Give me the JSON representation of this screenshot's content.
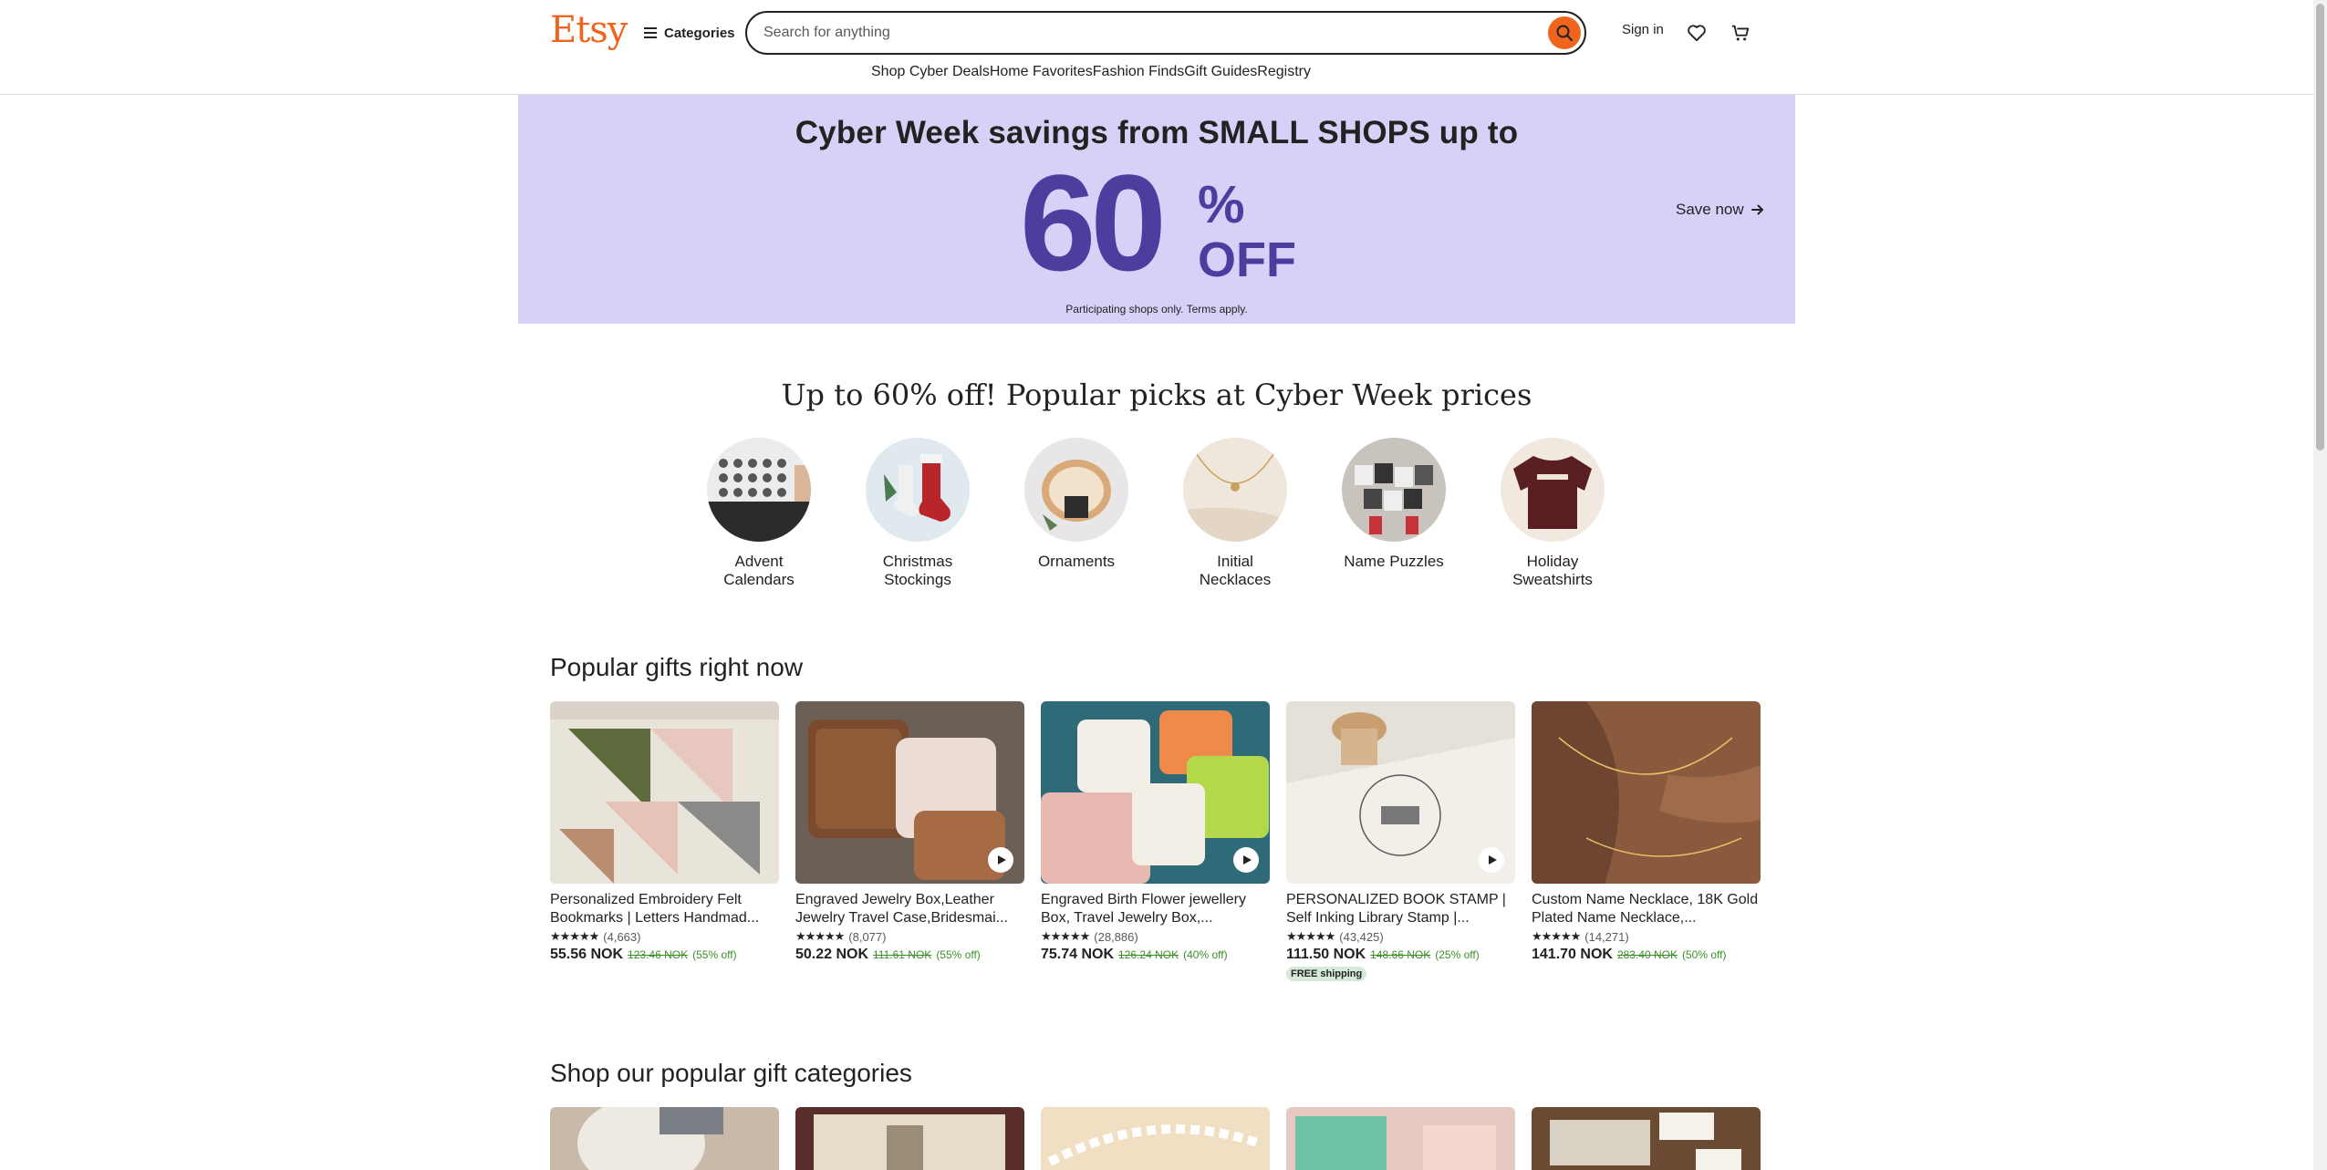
{
  "header": {
    "logo": "Etsy",
    "categories_label": "Categories",
    "search_placeholder": "Search for anything",
    "signin_label": "Sign in",
    "nav": [
      "Shop Cyber Deals",
      "Home Favorites",
      "Fashion Finds",
      "Gift Guides",
      "Registry"
    ]
  },
  "banner": {
    "headline": "Cyber Week savings from SMALL SHOPS up to",
    "big_number": "60",
    "percent": "%",
    "off": "OFF",
    "fine_print": "Participating shops only. Terms apply.",
    "cta": "Save now"
  },
  "picks": {
    "title": "Up to 60% off! Popular picks at Cyber Week prices",
    "items": [
      {
        "label": "Advent Calendars"
      },
      {
        "label": "Christmas Stockings"
      },
      {
        "label": "Ornaments"
      },
      {
        "label": "Initial Necklaces"
      },
      {
        "label": "Name Puzzles"
      },
      {
        "label": "Holiday Sweatshirts"
      }
    ]
  },
  "popular": {
    "title": "Popular gifts right now",
    "items": [
      {
        "title": "Personalized Embroidery Felt Bookmarks | Letters Handmad...",
        "stars": "★★★★★",
        "reviews": "(4,663)",
        "price": "55.56 NOK",
        "old_price": "123.46 NOK",
        "discount": "(55% off)"
      },
      {
        "title": "Engraved Jewelry Box,Leather Jewelry Travel Case,Bridesmai...",
        "stars": "★★★★★",
        "reviews": "(8,077)",
        "price": "50.22 NOK",
        "old_price": "111.61 NOK",
        "discount": "(55% off)"
      },
      {
        "title": "Engraved Birth Flower jewellery Box, Travel Jewelry Box,...",
        "stars": "★★★★★",
        "reviews": "(28,886)",
        "price": "75.74 NOK",
        "old_price": "126.24 NOK",
        "discount": "(40% off)"
      },
      {
        "title": "PERSONALIZED BOOK STAMP | Self Inking Library Stamp |...",
        "stars": "★★★★★",
        "reviews": "(43,425)",
        "price": "111.50 NOK",
        "old_price": "148.66 NOK",
        "discount": "(25% off)",
        "badge": "FREE shipping"
      },
      {
        "title": "Custom Name Necklace, 18K Gold Plated Name Necklace,...",
        "stars": "★★★★★",
        "reviews": "(14,271)",
        "price": "141.70 NOK",
        "old_price": "283.40 NOK",
        "discount": "(50% off)"
      }
    ]
  },
  "categories_section": {
    "title": "Shop our popular gift categories"
  },
  "icons": {
    "search": "search-icon",
    "heart": "heart-icon",
    "cart": "cart-icon",
    "menu": "hamburger-icon",
    "arrow": "arrow-right-icon",
    "play": "play-icon"
  },
  "colors": {
    "brand": "#f1641e",
    "banner_bg": "#d7d1f7",
    "banner_accent": "#4d3d9e",
    "discount_green": "#3d8e2b"
  }
}
